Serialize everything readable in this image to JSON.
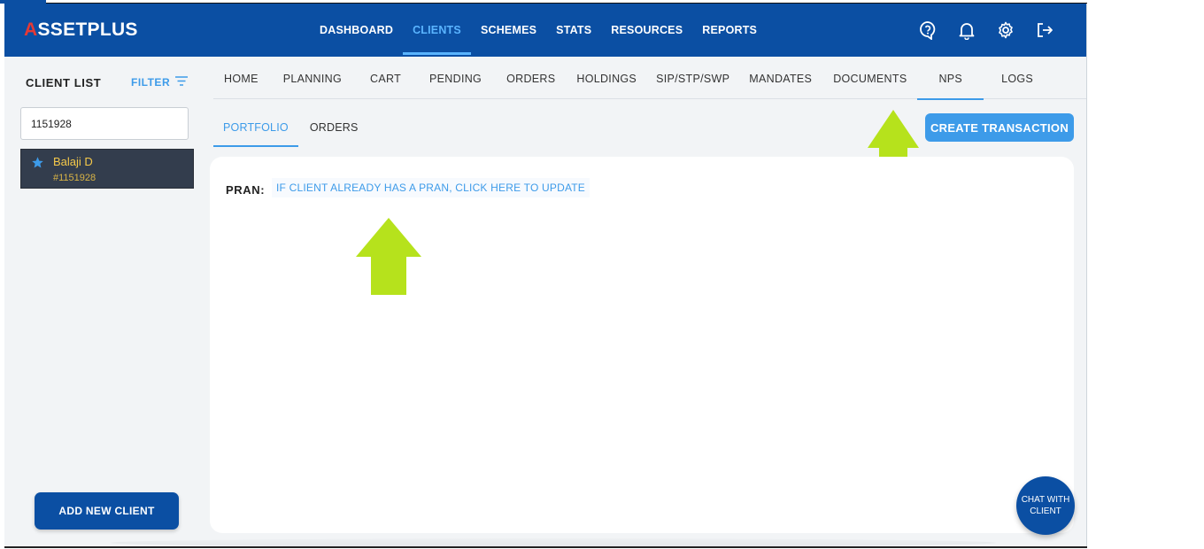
{
  "brand": {
    "logo_prefix": "A",
    "logo_rest": "SSETPLUS"
  },
  "topnav": {
    "items": [
      {
        "label": "DASHBOARD",
        "active": false
      },
      {
        "label": "CLIENTS",
        "active": true
      },
      {
        "label": "SCHEMES",
        "active": false
      },
      {
        "label": "STATS",
        "active": false
      },
      {
        "label": "RESOURCES",
        "active": false
      },
      {
        "label": "REPORTS",
        "active": false
      }
    ],
    "icons": [
      "help-icon",
      "bell-icon",
      "gear-icon",
      "logout-icon"
    ]
  },
  "sidebar": {
    "title": "CLIENT LIST",
    "filter_label": "FILTER",
    "search_value": "1151928",
    "client": {
      "name": "Balaji D",
      "id": "#1151928"
    },
    "add_client_label": "ADD NEW CLIENT"
  },
  "subnav": {
    "items": [
      {
        "label": "HOME"
      },
      {
        "label": "PLANNING"
      },
      {
        "label": "CART"
      },
      {
        "label": "PENDING"
      },
      {
        "label": "ORDERS"
      },
      {
        "label": "HOLDINGS"
      },
      {
        "label": "SIP/STP/SWP"
      },
      {
        "label": "MANDATES"
      },
      {
        "label": "DOCUMENTS"
      },
      {
        "label": "NPS",
        "active": true
      },
      {
        "label": "LOGS"
      }
    ]
  },
  "tabs": {
    "items": [
      {
        "label": "PORTFOLIO",
        "active": true
      },
      {
        "label": "ORDERS",
        "active": false
      }
    ],
    "create_label": "CREATE TRANSACTION"
  },
  "panel": {
    "pran_label": "PRAN:",
    "pran_link": "IF CLIENT ALREADY HAS A PRAN, CLICK HERE TO UPDATE"
  },
  "chat": {
    "label": "CHAT WITH CLIENT"
  },
  "colors": {
    "primary": "#0b4fa3",
    "accent": "#3d9be9",
    "highlight_arrow": "#b6e21c"
  }
}
